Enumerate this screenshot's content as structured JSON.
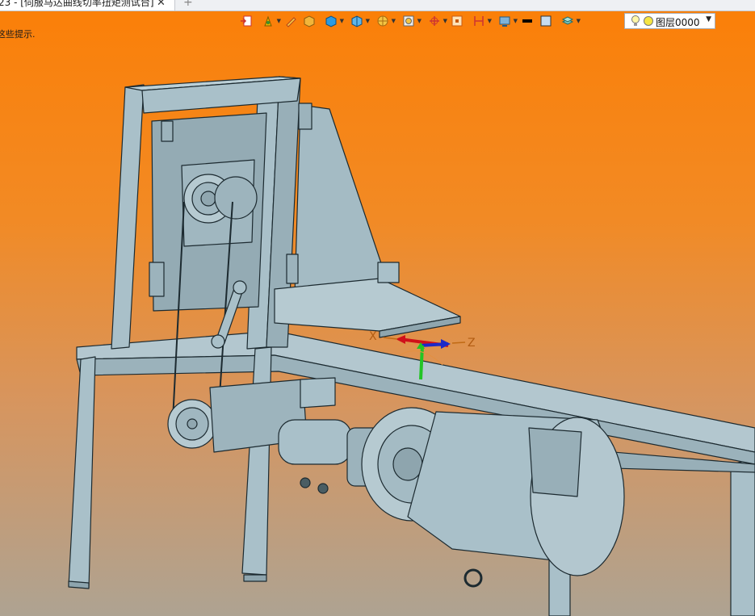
{
  "document_tab": {
    "title": "23 - [伺服马达曲线切率扭矩测试台]"
  },
  "new_tab_symbol": "+",
  "close_symbol": "✕",
  "hint_text": "这些提示.",
  "toolbar": {
    "items": [
      {
        "name": "import-icon"
      },
      {
        "name": "pour-icon"
      },
      {
        "name": "pen-icon"
      },
      {
        "name": "box-icon"
      },
      {
        "name": "cube-icon"
      },
      {
        "name": "shade-cube-icon"
      },
      {
        "name": "wheel-icon"
      },
      {
        "name": "zoom-fit-icon"
      },
      {
        "name": "rotate-icon"
      },
      {
        "name": "frame-icon"
      },
      {
        "name": "section-icon"
      },
      {
        "name": "display-icon"
      },
      {
        "name": "line-color-icon"
      },
      {
        "name": "fill-color-icon"
      },
      {
        "name": "layers-icon"
      }
    ]
  },
  "layer_select": {
    "value": "图层0000"
  },
  "axes": {
    "x_label": "X",
    "z_label": "Z"
  },
  "colors": {
    "bg_top": "#fb7f07",
    "bg_bottom": "#aea392",
    "part": "#a9c0c9",
    "edge": "#1c2a30"
  }
}
